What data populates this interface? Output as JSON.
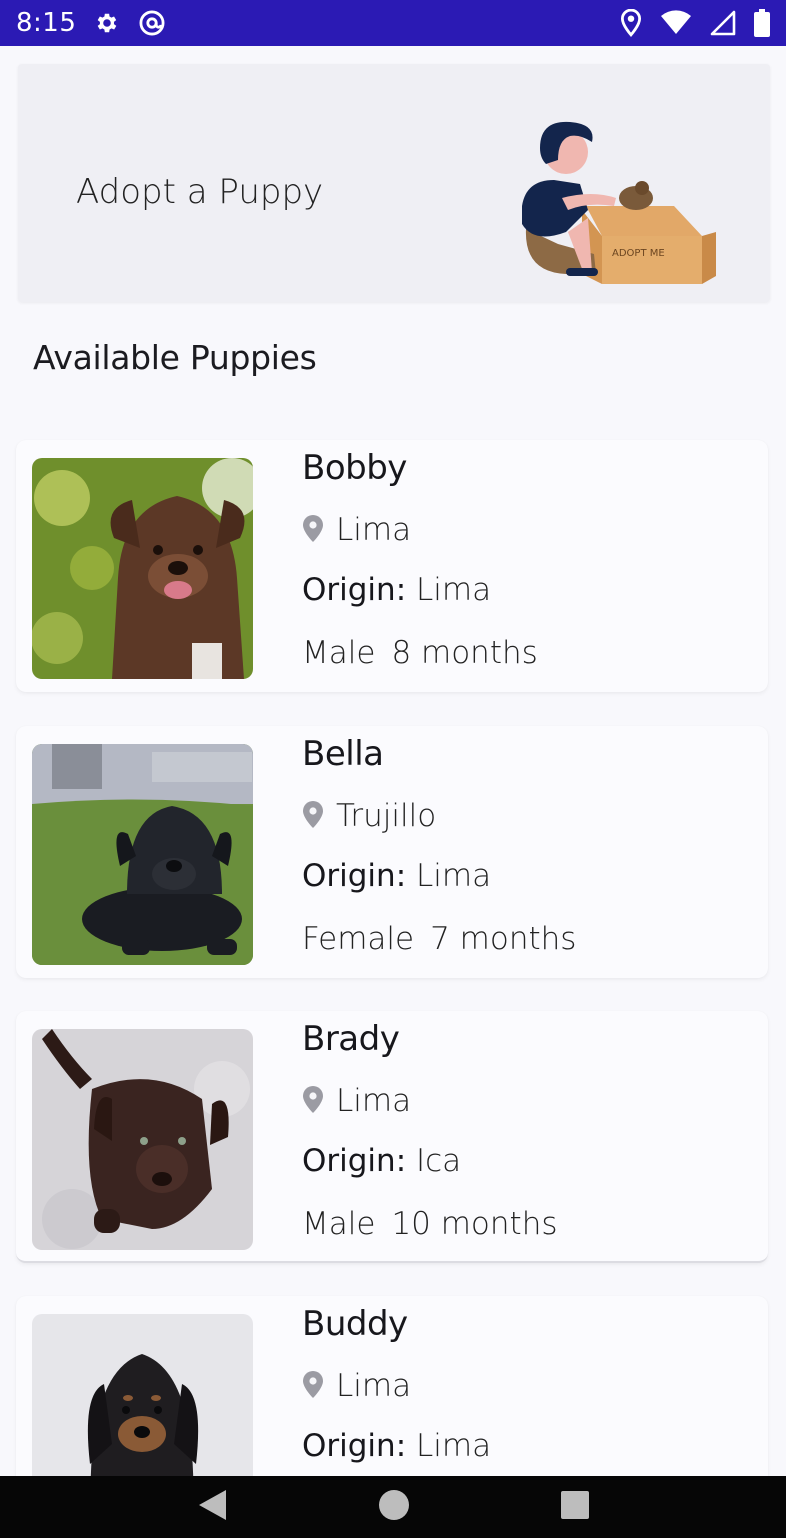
{
  "status_bar": {
    "time": "8:15",
    "icons_left": [
      "gear-icon",
      "at-sign-icon"
    ],
    "icons_right": [
      "location-pin-icon",
      "wifi-icon",
      "signal-icon",
      "battery-icon"
    ],
    "background": "#2b1ab4"
  },
  "banner": {
    "title": "Adopt a Puppy",
    "illustration": "boy-with-puppy-box-illustration",
    "box_text": "ADOPT ME"
  },
  "section_title": "Available Puppies",
  "puppies": [
    {
      "name": "Bobby",
      "location": "Lima",
      "origin_label": "Origin:",
      "origin": "Lima",
      "gender": "Male",
      "age": "8 months",
      "photo": "brown-puppy-photo"
    },
    {
      "name": "Bella",
      "location": "Trujillo",
      "origin_label": "Origin:",
      "origin": "Lima",
      "gender": "Female",
      "age": "7 months",
      "photo": "black-puppy-photo"
    },
    {
      "name": "Brady",
      "location": "Lima",
      "origin_label": "Origin:",
      "origin": "Ica",
      "gender": "Male",
      "age": "10 months",
      "photo": "chocolate-puppy-photo"
    },
    {
      "name": "Buddy",
      "location": "Lima",
      "origin_label": "Origin:",
      "origin": "Lima",
      "gender": "",
      "age": "",
      "photo": "dachshund-puppy-photo"
    }
  ],
  "nav_bar": {
    "buttons": [
      "back-button",
      "home-button",
      "recents-button"
    ]
  }
}
